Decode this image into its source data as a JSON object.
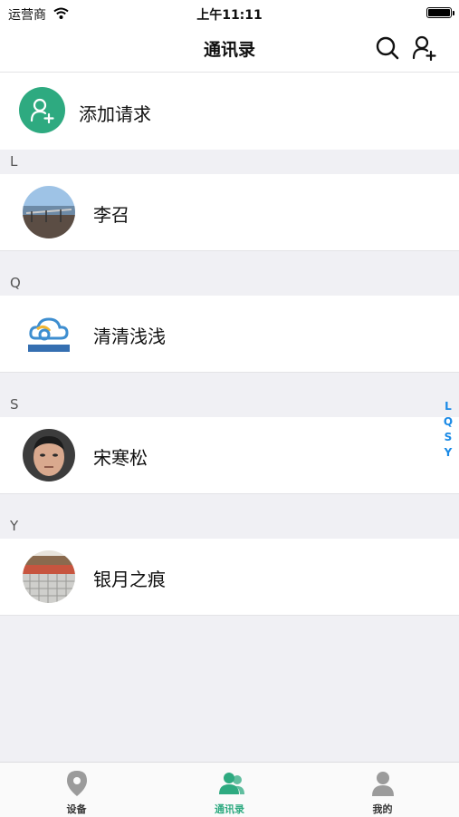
{
  "status_bar": {
    "carrier": "运营商",
    "time": "上午11:11"
  },
  "nav": {
    "title": "通讯录",
    "search_icon": "search-icon",
    "add_contact_icon": "add-user-icon"
  },
  "add_request": {
    "label": "添加请求",
    "icon": "add-user-icon",
    "accent": "#2eaa80"
  },
  "sections": [
    {
      "letter": "L",
      "contacts": [
        {
          "name": "李召",
          "avatar": "avatar-photo-seaside"
        }
      ]
    },
    {
      "letter": "Q",
      "contacts": [
        {
          "name": "清清浅浅",
          "avatar": "avatar-logo-cloud"
        }
      ]
    },
    {
      "letter": "S",
      "contacts": [
        {
          "name": "宋寒松",
          "avatar": "avatar-photo-portrait"
        }
      ]
    },
    {
      "letter": "Y",
      "contacts": [
        {
          "name": "银月之痕",
          "avatar": "avatar-photo-keyboard"
        }
      ]
    }
  ],
  "index_bar": [
    "L",
    "Q",
    "S",
    "Y"
  ],
  "tabs": [
    {
      "label": "设备",
      "icon": "location-pin-icon",
      "active": false
    },
    {
      "label": "通讯录",
      "icon": "contacts-icon",
      "active": true
    },
    {
      "label": "我的",
      "icon": "person-icon",
      "active": false
    }
  ],
  "colors": {
    "accent": "#2eaa80",
    "index": "#1a8ae6",
    "background": "#f0f0f4"
  }
}
